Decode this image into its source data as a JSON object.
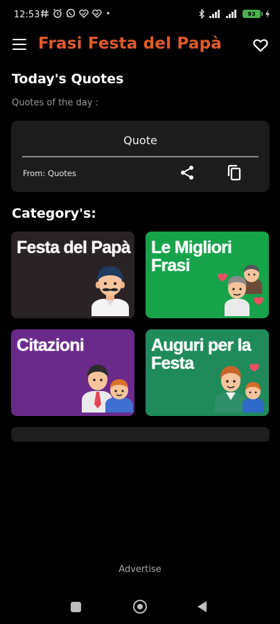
{
  "status_bar": {
    "time": "12:53",
    "battery": "93",
    "icons": [
      "hashtag-icon",
      "alarm-icon",
      "whatsapp-icon",
      "heart-check-icon",
      "heart-check-icon",
      "dot-icon",
      "bluetooth-icon",
      "signal-icon",
      "signal-icon",
      "battery-icon",
      "charging-icon"
    ]
  },
  "app_bar": {
    "title": "Frasi Festa del Papà",
    "title_color": "#e05a2a",
    "menu_icon": "hamburger-menu-icon",
    "favorites_icon": "heart-outline-icon"
  },
  "today": {
    "heading": "Today's Quotes",
    "subtitle": "Quotes of the day :",
    "quote": "Quote",
    "from": "From: Quotes",
    "share_icon": "share-icon",
    "copy_icon": "copy-icon"
  },
  "categories": {
    "heading": "Category's:",
    "items": [
      {
        "label": "Festa del Papà",
        "color": "#2a2326",
        "icon": "dad-avatar-icon"
      },
      {
        "label": "Le Migliori Frasi",
        "color": "#16a34a",
        "icon": "family-hearts-icon"
      },
      {
        "label": "Citazioni",
        "color": "#6a2a8a",
        "icon": "father-son-icon"
      },
      {
        "label": "Auguri per la Festa",
        "color": "#1f8a5a",
        "icon": "father-son-heart-icon"
      }
    ]
  },
  "footer": {
    "advertise": "Advertise"
  },
  "nav_bar": {
    "recents_icon": "square-icon",
    "home_icon": "circle-icon",
    "back_icon": "triangle-back-icon"
  }
}
